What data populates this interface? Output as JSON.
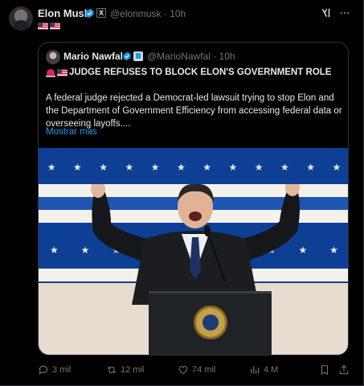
{
  "post": {
    "author_name": "Elon Musk",
    "author_handle": "@elonmusk",
    "time": "10h",
    "handle_time": "@elonmusk · 10h",
    "flags": [
      "us-flag",
      "us-flag"
    ]
  },
  "quote": {
    "author_name": "Mario Nawfal",
    "author_handle": "@MarioNawfal",
    "time": "10h",
    "handle_time": "@MarioNawfal · 10h",
    "headline": "JUDGE REFUSES TO BLOCK ELON'S GOVERNMENT ROLE",
    "headline_icons": [
      "siren-icon",
      "us-flag"
    ],
    "body": "A federal judge rejected a Democrat-led lawsuit trying to stop Elon and the Department of Government Efficiency from accessing federal data or overseeing layoffs....",
    "show_more": "Mostrar más"
  },
  "actions": {
    "replies": "3 mil",
    "reposts": "12 mil",
    "likes": "74 mil",
    "views": "4 M"
  },
  "colors": {
    "background": "#000000",
    "text": "#e7e9ea",
    "muted": "#71767b",
    "accent": "#1d9bf0",
    "border": "#2f3336"
  }
}
